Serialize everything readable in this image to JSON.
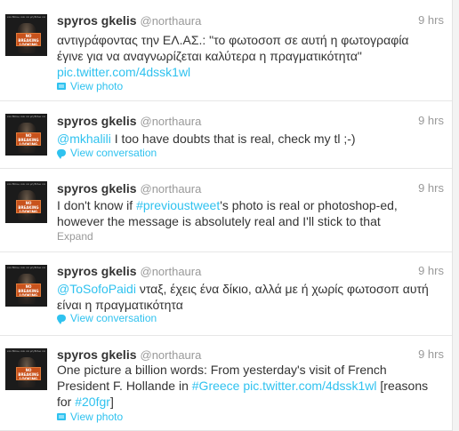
{
  "tweets": [
    {
      "name": "spyros gkelis",
      "handle": "@northaura",
      "time": "9 hrs",
      "segments": [
        {
          "t": "αντιγράφοντας την ΕΛ.ΑΣ.: \"το φωτοσοπ σε αυτή η φωτογραφία έγινε για να αναγνωρίζεται καλύτερα η πραγματικότητα\" ",
          "link": false
        },
        {
          "t": "pic.twitter.com/4dssk1wl",
          "link": true
        }
      ],
      "action": {
        "label": "View photo",
        "icon": "photo-icon",
        "style": "link"
      }
    },
    {
      "name": "spyros gkelis",
      "handle": "@northaura",
      "time": "9 hrs",
      "segments": [
        {
          "t": "@mkhalili",
          "link": true
        },
        {
          "t": " I too have doubts that is real, check my tl ;-)",
          "link": false
        }
      ],
      "action": {
        "label": "View conversation",
        "icon": "conversation-icon",
        "style": "link"
      }
    },
    {
      "name": "spyros gkelis",
      "handle": "@northaura",
      "time": "9 hrs",
      "segments": [
        {
          "t": "I don't know if ",
          "link": false
        },
        {
          "t": "#previoustweet",
          "link": true
        },
        {
          "t": "'s photo is real or photoshop-ed, however the message is absolutely real and I'll stick to that",
          "link": false
        }
      ],
      "action": {
        "label": "Expand",
        "icon": "",
        "style": "expand"
      }
    },
    {
      "name": "spyros gkelis",
      "handle": "@northaura",
      "time": "9 hrs",
      "segments": [
        {
          "t": "@ToSofoPaidi",
          "link": true
        },
        {
          "t": " νταξ, έχεις ένα δίκιο, αλλά με ή χωρίς φωτοσοπ αυτή είναι η πραγματικότητα",
          "link": false
        }
      ],
      "action": {
        "label": "View conversation",
        "icon": "conversation-icon",
        "style": "link"
      }
    },
    {
      "name": "spyros gkelis",
      "handle": "@northaura",
      "time": "9 hrs",
      "segments": [
        {
          "t": "One picture a billion words: From yesterday's visit of French President F. Hollande in ",
          "link": false
        },
        {
          "t": "#Greece",
          "link": true
        },
        {
          "t": " ",
          "link": false
        },
        {
          "t": "pic.twitter.com/4dssk1wl",
          "link": true
        },
        {
          "t": " [reasons for ",
          "link": false
        },
        {
          "t": "#20fgr",
          "link": true
        },
        {
          "t": "]",
          "link": false
        }
      ],
      "action": {
        "label": "View photo",
        "icon": "photo-icon",
        "style": "link"
      }
    }
  ],
  "avatar": {
    "caption": "και θέλω, και να μη θέλω να πάω",
    "sign": "NO BREAKING\nLOOKING"
  },
  "colors": {
    "link": "#2fc2ef",
    "name": "#333333",
    "meta": "#999999"
  }
}
